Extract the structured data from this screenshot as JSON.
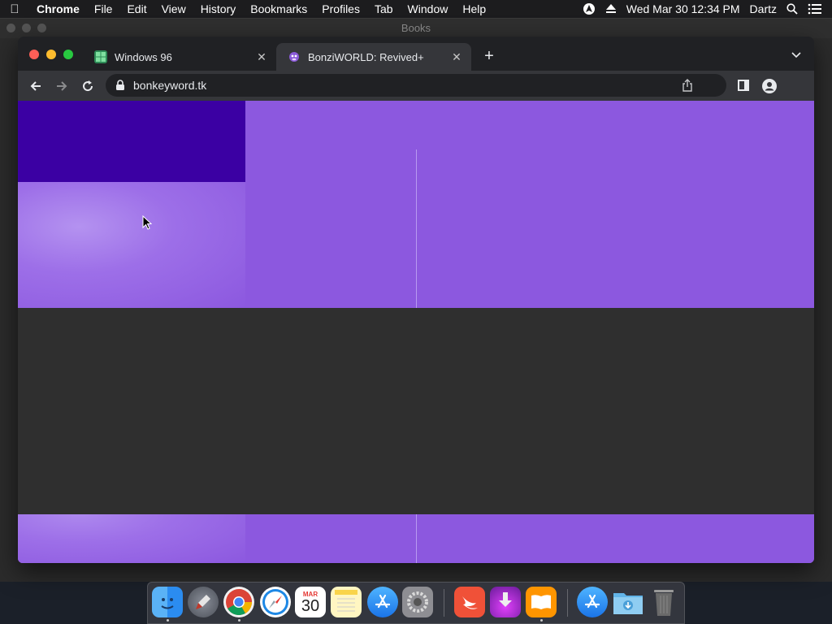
{
  "menubar": {
    "app_name": "Chrome",
    "items": [
      "File",
      "Edit",
      "View",
      "History",
      "Bookmarks",
      "Profiles",
      "Tab",
      "Window",
      "Help"
    ],
    "datetime": "Wed Mar 30  12:34 PM",
    "user": "Dartz"
  },
  "background_window": {
    "title": "Books"
  },
  "browser": {
    "tabs": [
      {
        "title": "Windows 96",
        "active": false,
        "favicon": "windows96-icon"
      },
      {
        "title": "BonziWORLD: Revived+",
        "active": true,
        "favicon": "bonzi-icon"
      }
    ],
    "url": "bonkeyword.tk"
  },
  "colors": {
    "page_purple": "#8c58df",
    "dark_block": "#3b00a3",
    "gray_band": "#2f2f2f"
  },
  "dock": {
    "apps": [
      "finder",
      "launchpad",
      "chrome",
      "safari",
      "calendar",
      "notes",
      "app-store",
      "system-preferences",
      "swift-playgrounds",
      "downloader",
      "books",
      "app-store-folder",
      "downloads-folder",
      "trash"
    ],
    "calendar_month": "MAR",
    "calendar_day": "30"
  }
}
